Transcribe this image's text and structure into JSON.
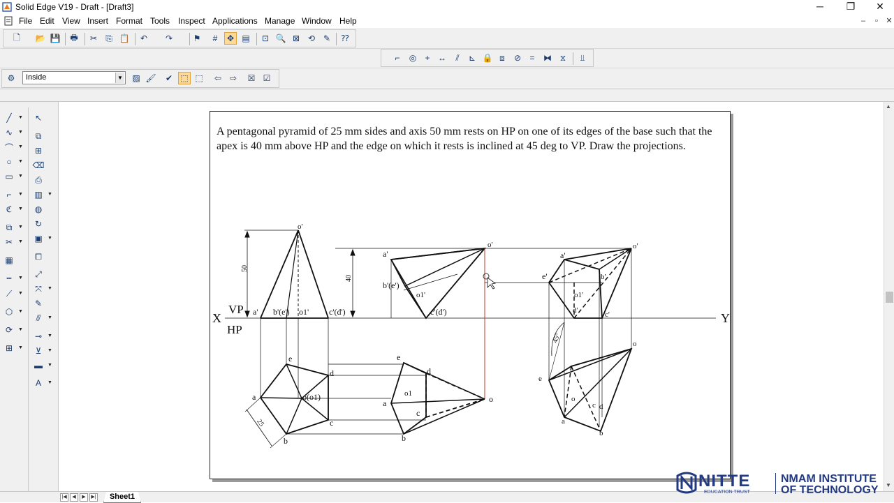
{
  "window": {
    "title": "Solid Edge V19 - Draft - [Draft3]",
    "controls": {
      "minimize": "─",
      "restore": "❐",
      "close": "✕"
    }
  },
  "menu": {
    "items": [
      "File",
      "Edit",
      "View",
      "Insert",
      "Format",
      "Tools",
      "Inspect",
      "Applications",
      "Manage",
      "Window",
      "Help"
    ],
    "mdi_controls": {
      "minimize": "–",
      "restore": "▫",
      "close": "✕"
    }
  },
  "ribbon": {
    "combo_value": "Inside"
  },
  "document": {
    "problem_text": "A pentagonal pyramid of 25 mm sides and axis 50 mm rests on HP on one of its edges of the base such that the apex is 40 mm above HP and the edge on which it rests is inclined at 45 deg to VP. Draw the projections."
  },
  "drawing_labels": {
    "X": "X",
    "Y": "Y",
    "VP": "VP",
    "HP": "HP",
    "apex_fv": "o'",
    "a_fv": "a'",
    "be_fv": "b'(e')",
    "o1_fv": "o1'",
    "cd_fv": "c'(d')",
    "dim_50": "50",
    "dim_40": "40",
    "dim_25": "25",
    "dim_45": "45°",
    "a_tv": "a",
    "b_tv": "b",
    "c_tv": "c",
    "d_tv": "d",
    "e_tv": "e",
    "o_tv": "o(o1)",
    "o1_tv": "o1",
    "o_tv2": "o",
    "c_fv": "c'",
    "d_fv": "d'",
    "e_fv": "e'",
    "b_fv": "b'"
  },
  "status": {
    "sheet_tab": "Sheet1",
    "nav_buttons": [
      "|◀",
      "◀",
      "▶",
      "▶|"
    ]
  },
  "watermark": {
    "brand": "NITTE",
    "trust": "EDUCATION TRUST",
    "institute_line1": "NMAM INSTITUTE",
    "institute_line2": "OF TECHNOLOGY"
  },
  "colors": {
    "chrome": "#f0f0f0",
    "watermark_blue": "#233a82",
    "projector_red": "#c0392b"
  }
}
